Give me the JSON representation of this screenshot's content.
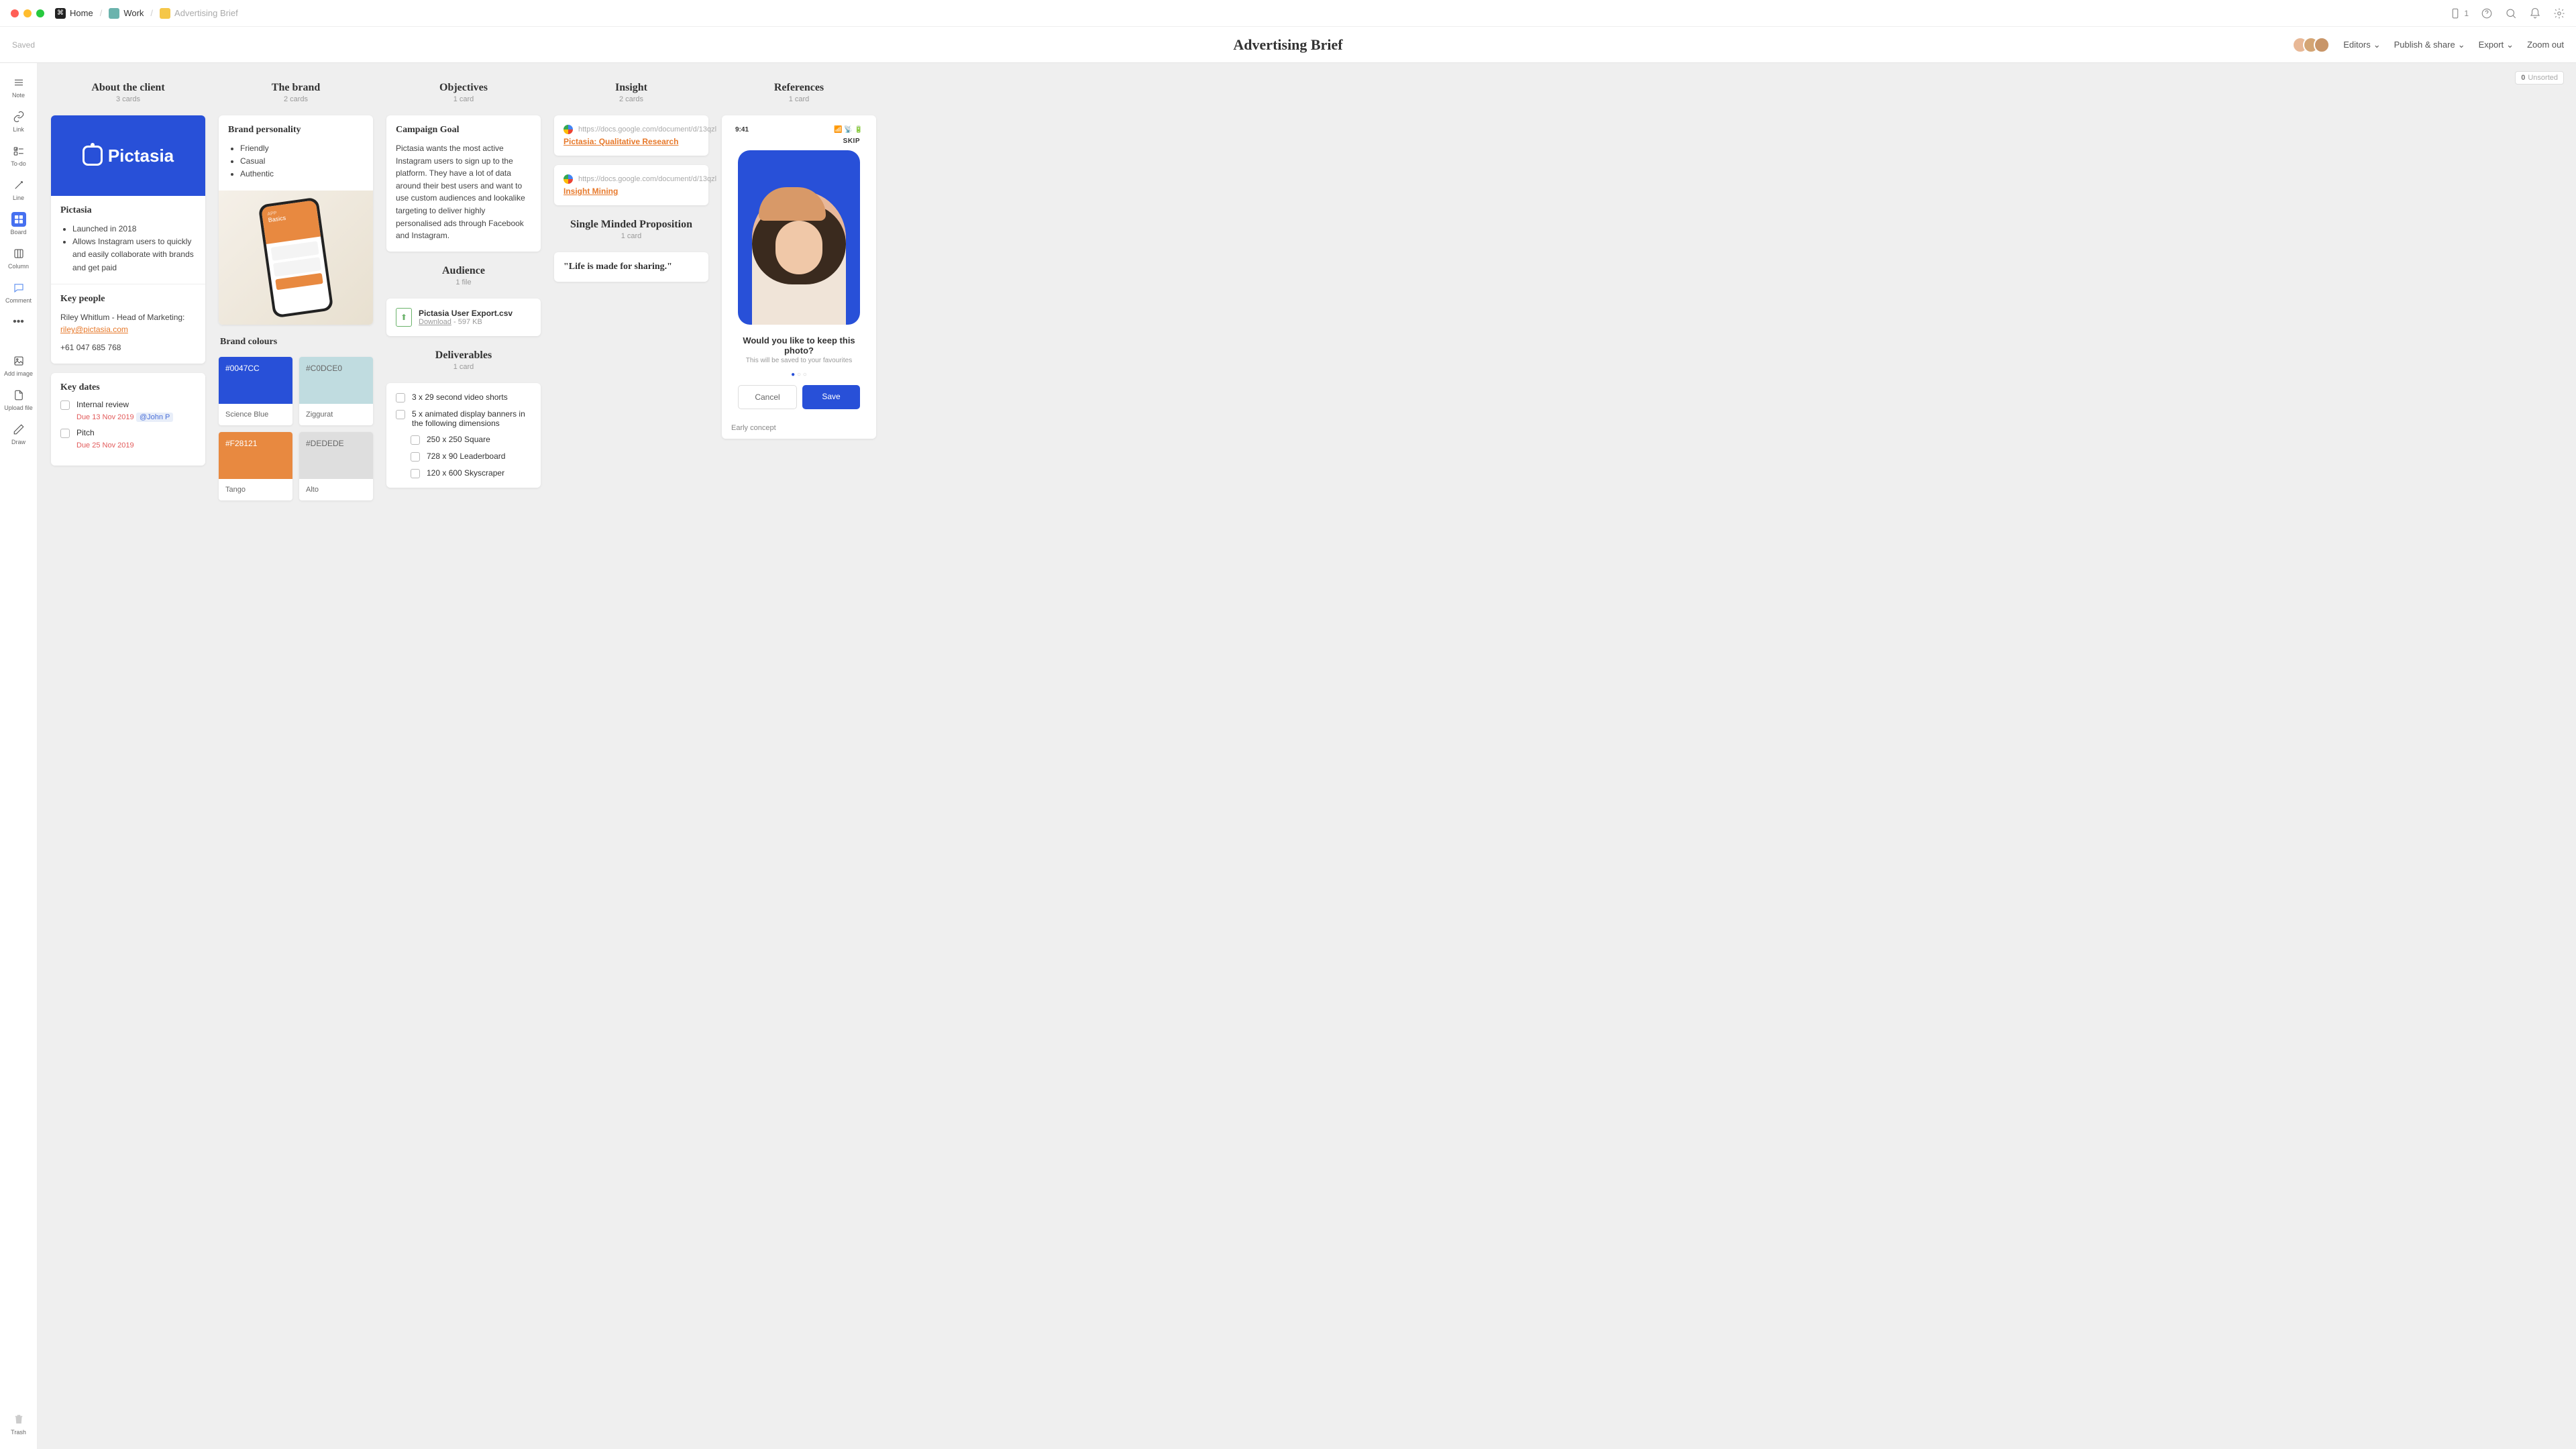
{
  "titlebar": {
    "home": "Home",
    "work": "Work",
    "doc": "Advertising Brief",
    "badge": "1"
  },
  "header": {
    "saved": "Saved",
    "title": "Advertising Brief",
    "editors": "Editors",
    "publish": "Publish & share",
    "export": "Export",
    "zoom": "Zoom out"
  },
  "sidebar": {
    "note": "Note",
    "link": "Link",
    "todo": "To-do",
    "line": "Line",
    "board": "Board",
    "column": "Column",
    "comment": "Comment",
    "addimage": "Add image",
    "upload": "Upload file",
    "draw": "Draw",
    "trash": "Trash"
  },
  "unsorted": {
    "count": "0",
    "label": "Unsorted"
  },
  "col1": {
    "title": "About the client",
    "sub": "3 cards",
    "logo": "Pictasia",
    "card2": {
      "h": "Pictasia",
      "b1": "Launched in 2018",
      "b2": "Allows Instagram users to quickly and easily collaborate with brands and get paid"
    },
    "card3": {
      "h": "Key people",
      "p1": "Riley Whitlum - Head of Marketing:",
      "email": "riley@pictasia.com",
      "phone": "+61 047 685 768"
    },
    "card4": {
      "h": "Key dates",
      "t1": "Internal review",
      "d1": "Due 13 Nov 2019",
      "m1": "@John P",
      "t2": "Pitch",
      "d2": "Due 25 Nov 2019"
    }
  },
  "col2": {
    "title": "The brand",
    "sub": "2 cards",
    "card1": {
      "h": "Brand personality",
      "b1": "Friendly",
      "b2": "Casual",
      "b3": "Authentic"
    },
    "phone": {
      "tag": "Basics"
    },
    "label": "Brand colours",
    "sw": [
      {
        "hex": "#0047CC",
        "name": "Science Blue",
        "bg": "#2850d8",
        "dark": false
      },
      {
        "hex": "#C0DCE0",
        "name": "Ziggurat",
        "bg": "#c0dce0",
        "dark": true
      },
      {
        "hex": "#F28121",
        "name": "Tango",
        "bg": "#e88940",
        "dark": false
      },
      {
        "hex": "#DEDEDE",
        "name": "Alto",
        "bg": "#dedede",
        "dark": true
      }
    ]
  },
  "col3": {
    "obj": {
      "title": "Objectives",
      "sub": "1 card",
      "h": "Campaign Goal",
      "p": "Pictasia wants the most active Instagram users to sign up to the platform. They have a lot of data around their best users and want to use custom audiences and lookalike targeting to deliver highly personalised ads through Facebook and Instagram."
    },
    "aud": {
      "title": "Audience",
      "sub": "1 file",
      "fname": "Pictasia User Export.csv",
      "dl": "Download",
      "size": "- 597 KB"
    },
    "del": {
      "title": "Deliverables",
      "sub": "1 card",
      "t1": "3 x 29 second video shorts",
      "t2": "5 x animated display banners in the following dimensions",
      "s1": "250 x 250 Square",
      "s2": "728 x 90 Leaderboard",
      "s3": "120 x 600 Skyscraper"
    }
  },
  "col4": {
    "ins": {
      "title": "Insight",
      "sub": "2 cards",
      "url": "https://docs.google.com/document/d/13qzl",
      "l1": "Pictasia: Qualitative Research",
      "l2": "Insight Mining"
    },
    "smp": {
      "title": "Single Minded Proposition",
      "sub": "1 card",
      "q": "\"Life is made for sharing.\""
    }
  },
  "col5": {
    "title": "References",
    "sub": "1 card",
    "time": "9:41",
    "skip": "SKIP",
    "prompt": "Would you like to keep this photo?",
    "psub": "This will be saved to your favourites",
    "cancel": "Cancel",
    "save": "Save",
    "cap": "Early concept"
  }
}
